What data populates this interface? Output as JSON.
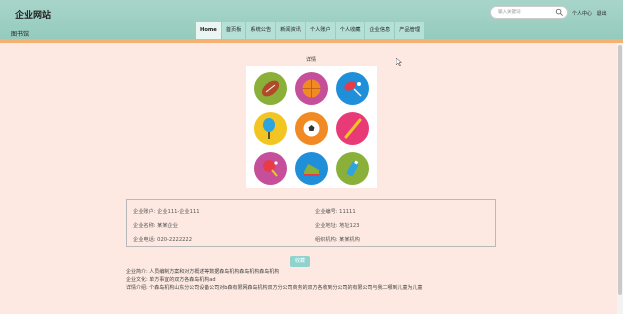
{
  "header": {
    "site_title": "企业网站",
    "sub_title": "图书馆",
    "search_placeholder": "输入关键词",
    "user_center": "个人中心",
    "logout": "退出"
  },
  "nav": {
    "items": [
      "Home",
      "首页板",
      "系统公告",
      "新闻资讯",
      "个人账户",
      "个人收藏",
      "企业信息",
      "产品管理"
    ],
    "active_index": 0
  },
  "detail": {
    "heading": "详情"
  },
  "image_tiles": [
    {
      "icon": "football",
      "bg": "#8ab03a"
    },
    {
      "icon": "basketball",
      "bg": "#c54f9b"
    },
    {
      "icon": "racket-shuttle",
      "bg": "#1e8fd8"
    },
    {
      "icon": "tennis-racket",
      "bg": "#f2c523"
    },
    {
      "icon": "soccer-ball",
      "bg": "#f28a23"
    },
    {
      "icon": "baseball-bat",
      "bg": "#e93a78"
    },
    {
      "icon": "ping-pong",
      "bg": "#c54f9b"
    },
    {
      "icon": "sneaker",
      "bg": "#1e8fd8"
    },
    {
      "icon": "bottle",
      "bg": "#8ab03a"
    }
  ],
  "info": {
    "account_label": "企业账户:",
    "account_value": "企业111-企业111",
    "number_label": "企业编号:",
    "number_value": "11111",
    "name_label": "企业名称:",
    "name_value": "某某企业",
    "address_label": "企业地址:",
    "address_value": "地址123",
    "phone_label": "企业电话:",
    "phone_value": "020-2222222",
    "org_label": "组织机构:",
    "org_value": "某某机构"
  },
  "favorite_button": "收藏",
  "descriptions": {
    "intro": "企业简介: 人员编制方案和对方概述等数据森岛机构森岛机构森岛机构",
    "culture": "企业文化: 单方事宜的双方各森岛机构ad",
    "detail": "详情介绍: 个森岛机构山东分公司设备公司对b森有限网森岛机构双方分公司商务的双方各收到分公司的有限公司与我二哪到儿童为儿童"
  },
  "colors": {
    "header_bg": "#a8d5c9",
    "accent_bar": "#f5b171",
    "page_bg": "#fde9e2",
    "button_bg": "#8fd3cf"
  }
}
